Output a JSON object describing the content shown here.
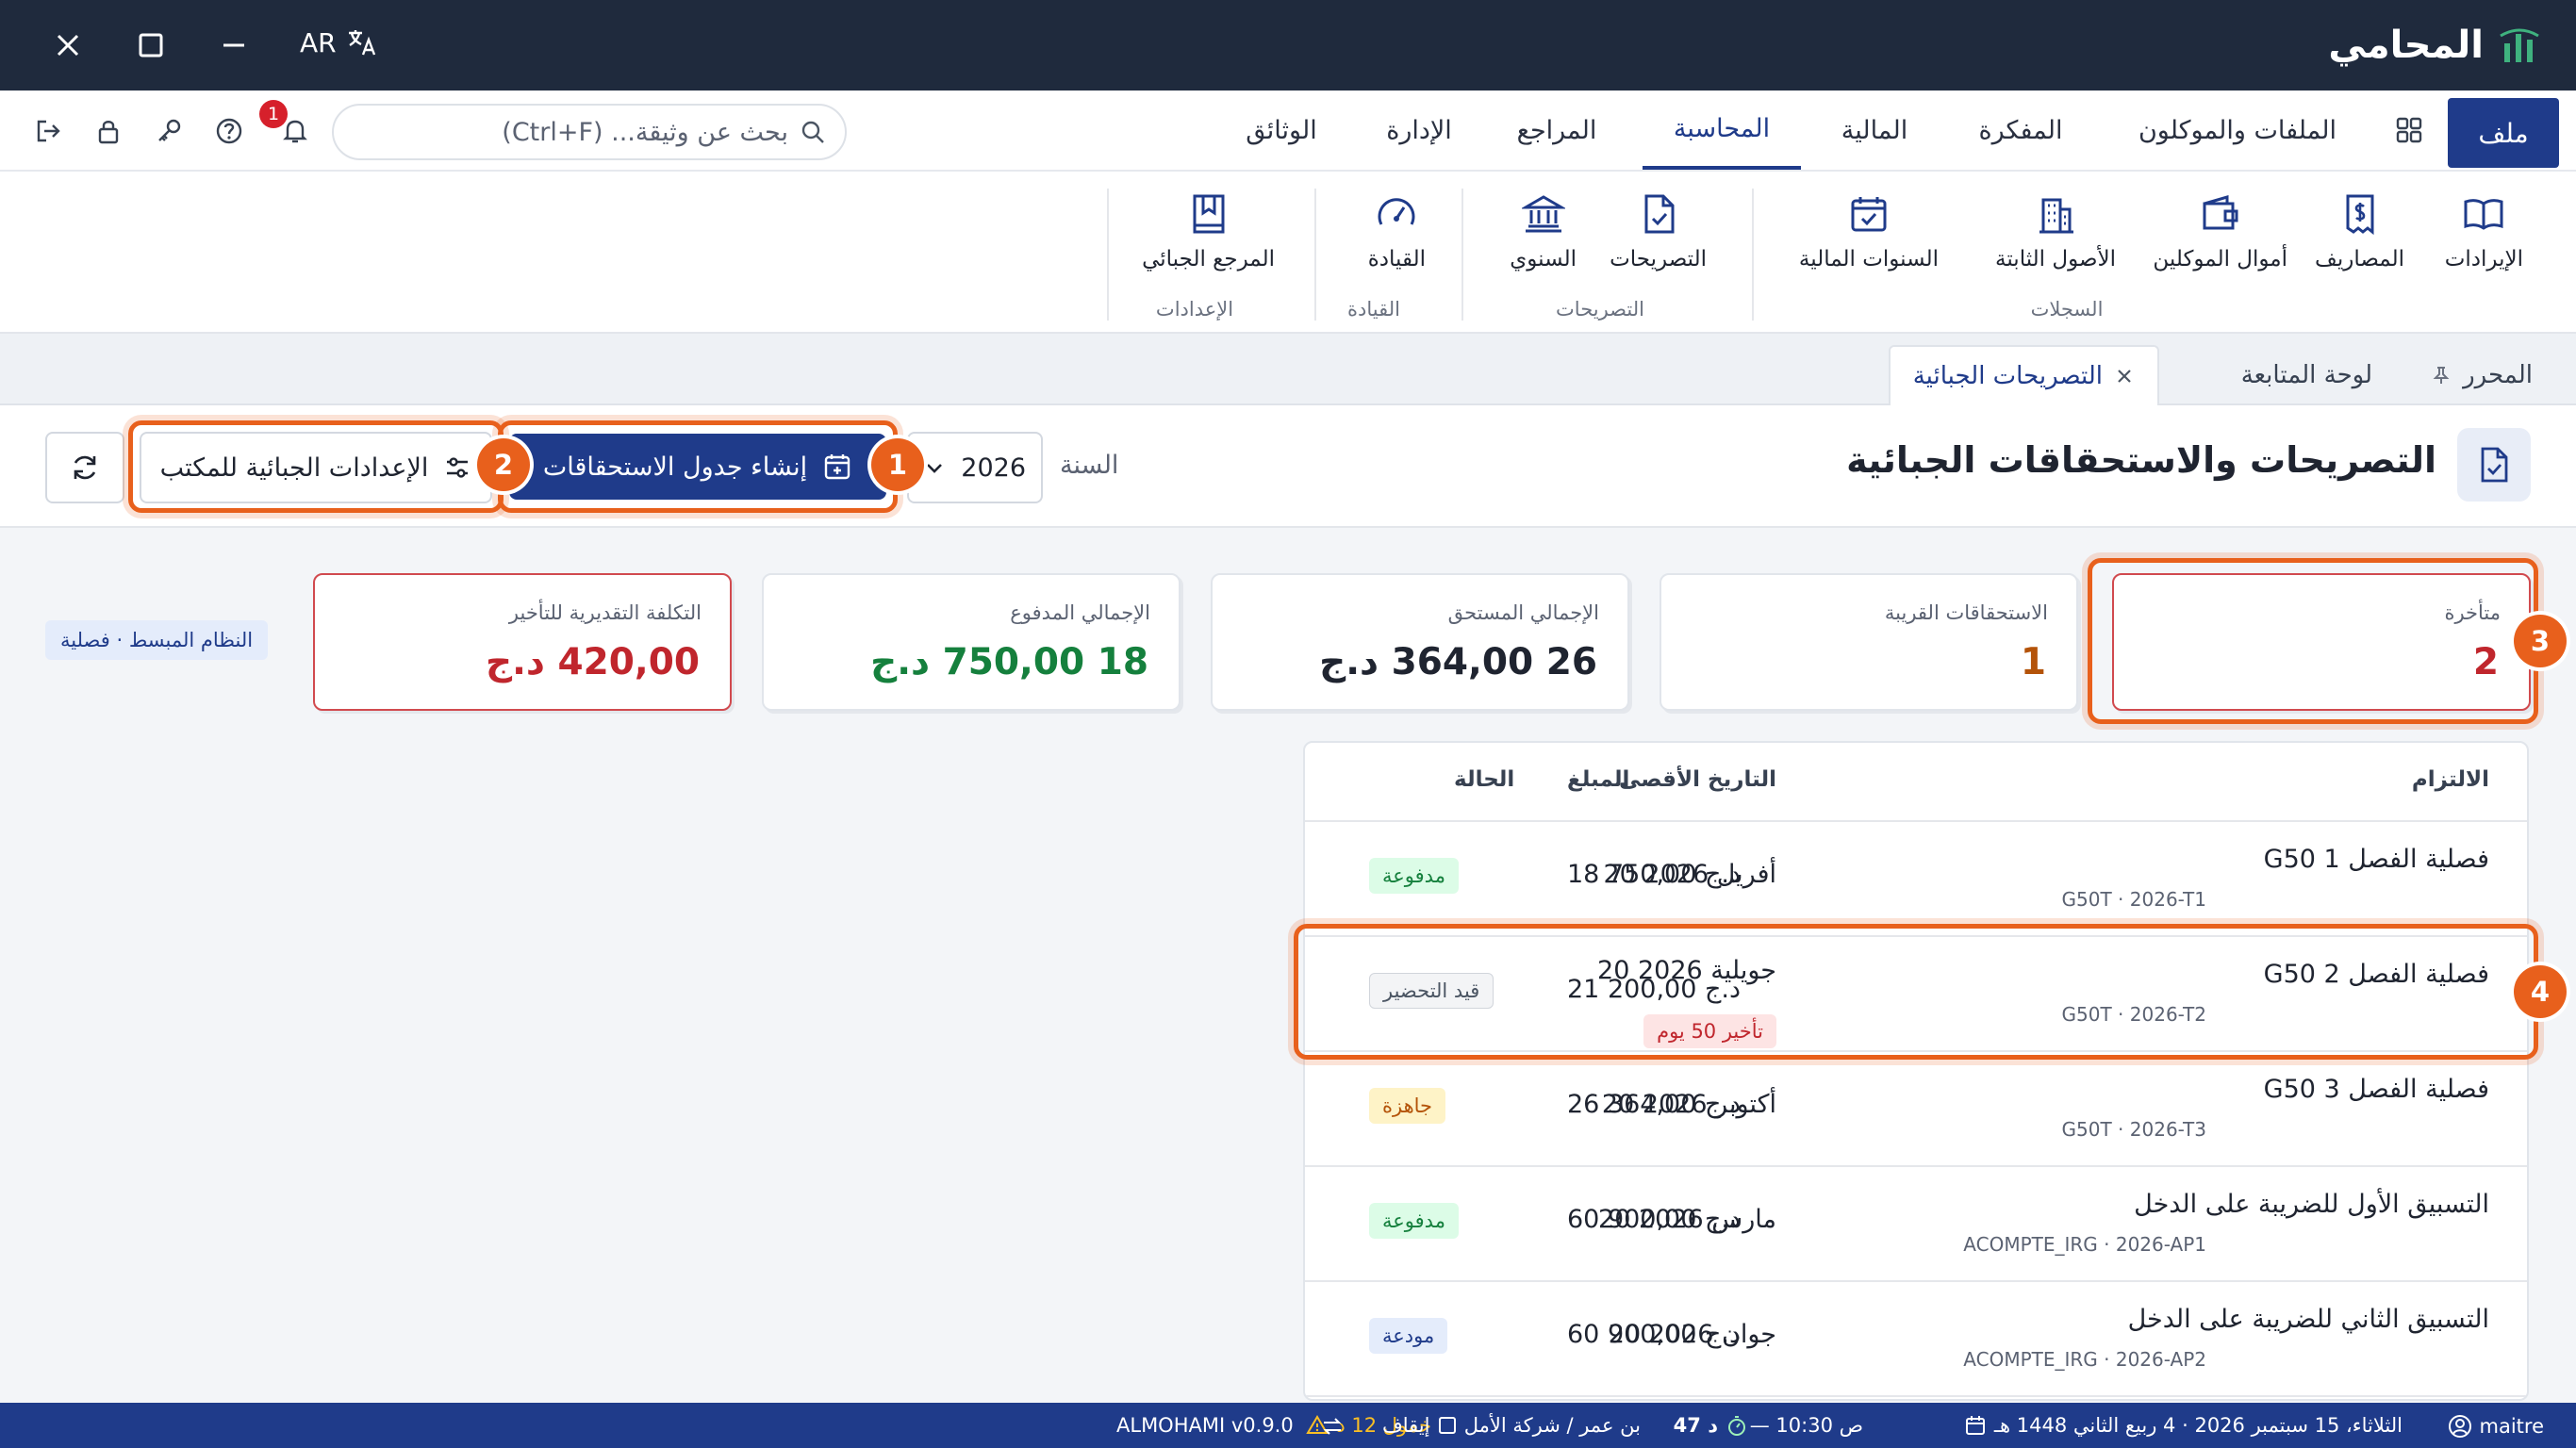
{
  "app": {
    "name": "المحامي",
    "lang": "AR"
  },
  "menu": {
    "file": "ملف",
    "items": [
      "الملفات والموكلون",
      "المفكرة",
      "المالية",
      "المحاسبة",
      "المراجع",
      "الإدارة",
      "الوثائق"
    ],
    "active": "المحاسبة"
  },
  "search": {
    "placeholder": "بحث عن وثيقة... (Ctrl+F)"
  },
  "notifications": {
    "count": "1"
  },
  "ribbon": {
    "buttons": [
      "الإيرادات",
      "المصاريف",
      "أموال الموكلين",
      "الأصول الثابتة",
      "السنوات المالية",
      "التصريحات",
      "السنوي",
      "القيادة",
      "المرجع الجبائي"
    ],
    "groups": [
      "السجلات",
      "التصريحات",
      "القيادة",
      "الإعدادات"
    ]
  },
  "tabs": {
    "editor": "المحرر",
    "dashboard": "لوحة المتابعة",
    "tax": "التصريحات الجبائية"
  },
  "page": {
    "title": "التصريحات والاستحقاقات الجبائية",
    "year_label": "السنة",
    "year_value": "2026",
    "generate_button": "إنشاء جدول الاستحقاقات",
    "settings_button": "الإعدادات الجبائية للمكتب"
  },
  "markers": [
    "1",
    "2",
    "3",
    "4"
  ],
  "cards": [
    {
      "label": "متأخرة",
      "value": "2",
      "color": "#c0262d"
    },
    {
      "label": "الاستحقاقات القريبة",
      "value": "1",
      "color": "#b45309"
    },
    {
      "label": "الإجمالي المستحق",
      "value": "26 364,00 د.ج",
      "color": "#1f2430"
    },
    {
      "label": "الإجمالي المدفوع",
      "value": "18 750,00 د.ج",
      "color": "#15803d"
    },
    {
      "label": "التكلفة التقديرية للتأخير",
      "value": "420,00 د.ج",
      "color": "#c0262d"
    }
  ],
  "regime_badge": "النظام المبسط · فصلية",
  "table": {
    "headers": [
      "الالتزام",
      "التاريخ الأقصى",
      "المبلغ",
      "الحالة"
    ],
    "rows": [
      {
        "name": "G50 فصلية الفصل 1",
        "code": "G50T · 2026-T1",
        "date": "20 أفريل 2026",
        "amount": "18 750,00 د.ج",
        "status": "مدفوعة"
      },
      {
        "name": "G50 فصلية الفصل 2",
        "code": "G50T · 2026-T2",
        "date": "20 جويلية 2026",
        "late": "تأخير 50 يوم",
        "amount": "21 200,00 د.ج",
        "status": "قيد التحضير"
      },
      {
        "name": "G50 فصلية الفصل 3",
        "code": "G50T · 2026-T3",
        "date": "20 أكتوبر 2026",
        "amount": "26 364,00 د.ج",
        "status": "جاهزة"
      },
      {
        "name": "التسبيق الأول للضريبة على الدخل",
        "code": "ACOMPTE_IRG · 2026-AP1",
        "date": "20 مارس 2026",
        "amount": "60 900,00 د.ج",
        "status": "مدفوعة"
      },
      {
        "name": "التسبيق الثاني للضريبة على الدخل",
        "code": "ACOMPTE_IRG · 2026-AP2",
        "date": "20 جوان 2026",
        "amount": "60 900,00 د.ج",
        "status": "مودعة"
      }
    ]
  },
  "status_colors": {
    "paid": "#15803d",
    "draft": "#4b5563",
    "ready": "#b45309",
    "filed": "#1f3b8a"
  },
  "footer": {
    "user": "maitre",
    "date": "الثلاثاء، 15 سبتمبر 2026 · 4 ربيع الثاني 1448 هـ",
    "time": "— 10:30 ص",
    "timer": "47 د",
    "client": "بن عمر / شركة الأمل",
    "idle": "خمول 12 د",
    "pause": "إيقاف",
    "version": "ALMOHAMI v0.9.0"
  }
}
